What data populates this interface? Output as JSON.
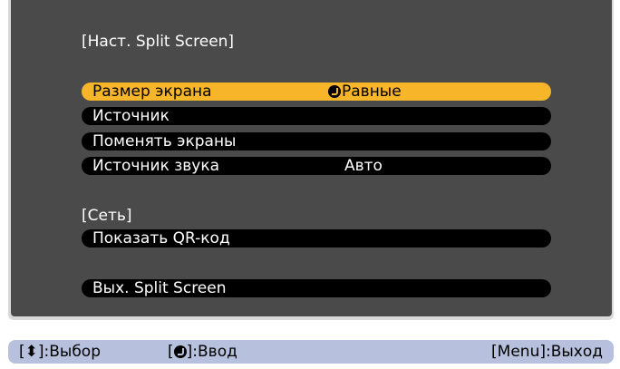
{
  "menu": {
    "title": "[Наст. Split Screen]",
    "items": [
      {
        "label": "Размер экрана",
        "value": "Равные",
        "selected": true
      },
      {
        "label": "Источник",
        "value": ""
      },
      {
        "label": "Поменять экраны",
        "value": ""
      },
      {
        "label": "Источник звука",
        "value": "Авто"
      }
    ],
    "network_header": "[Сеть]",
    "network_items": [
      {
        "label": "Показать QR-код"
      }
    ],
    "exit_label": "Вых. Split Screen"
  },
  "status": {
    "select_key": "[⬍]",
    "select_label": ":Выбор",
    "enter_key_open": "[",
    "enter_key_close": "]",
    "enter_label": ":Ввод",
    "exit_hint": "[Menu]:Выход"
  },
  "colors": {
    "panel": "#4a4a4a",
    "highlight": "#f7b52a",
    "item_bg": "#000000",
    "status_bg": "#b7c1dd"
  },
  "icons": {
    "enter": "enter-icon",
    "updown": "updown-arrow-icon"
  }
}
